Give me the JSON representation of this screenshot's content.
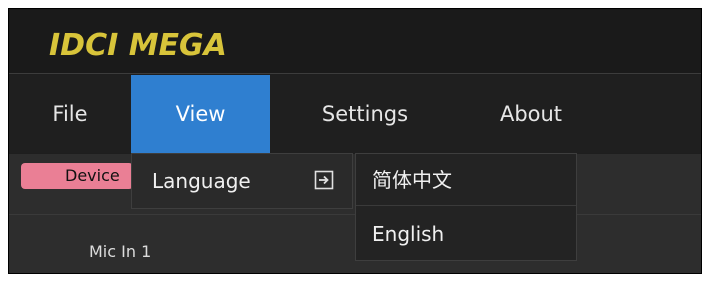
{
  "app": {
    "logo_text": "IDCI MEGA",
    "logo_color": "#d8c43a"
  },
  "menubar": {
    "items": [
      {
        "label": "File"
      },
      {
        "label": "View"
      },
      {
        "label": "Settings"
      },
      {
        "label": "About"
      }
    ],
    "active_item": "View",
    "active_color": "#2f7fd0"
  },
  "view_menu": {
    "items": [
      {
        "label": "Language",
        "icon": "submenu-arrow-icon"
      }
    ]
  },
  "language_submenu": {
    "items": [
      {
        "label": "简体中文"
      },
      {
        "label": "English"
      }
    ]
  },
  "panel": {
    "device_tab_label": "Device",
    "device_tab_color": "#ea7f95",
    "channel_label": "Mic In 1"
  }
}
